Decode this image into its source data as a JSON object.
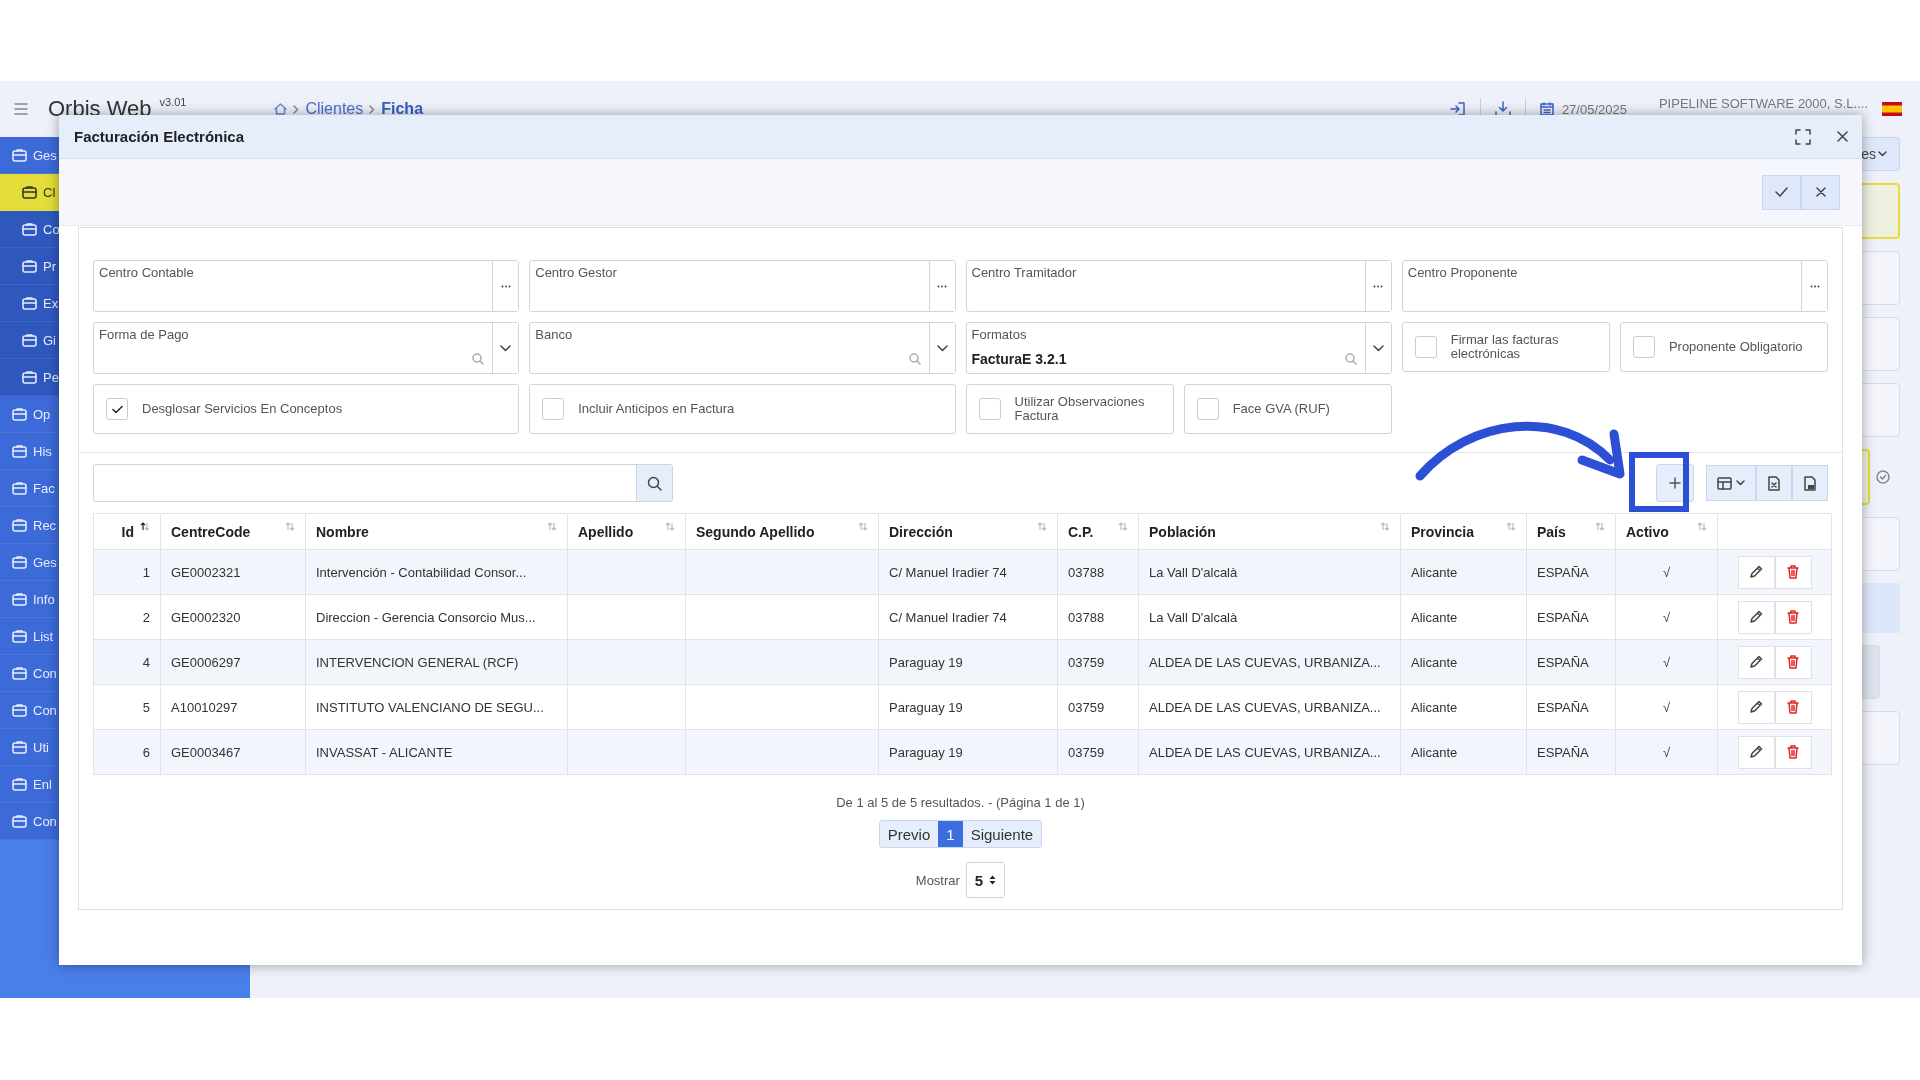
{
  "app": {
    "logo": "Orbis Web",
    "version": "v3.01",
    "breadcrumbs": [
      {
        "label": "Clientes",
        "current": false
      },
      {
        "label": "Ficha",
        "current": true
      }
    ],
    "date": "27/05/2025",
    "company": "PIPELINE SOFTWARE 2000, S.L...."
  },
  "sidebar": {
    "items": [
      {
        "label": "Ges",
        "kind": "group",
        "selected": false
      },
      {
        "label": "Cl",
        "kind": "sub",
        "selected": true
      },
      {
        "label": "Co",
        "kind": "sub",
        "selected": false
      },
      {
        "label": "Pr",
        "kind": "sub",
        "selected": false
      },
      {
        "label": "Ex",
        "kind": "sub",
        "selected": false
      },
      {
        "label": "Gi",
        "kind": "sub",
        "selected": false
      },
      {
        "label": "Pe",
        "kind": "sub",
        "selected": false
      },
      {
        "label": "Op",
        "kind": "group",
        "selected": false
      },
      {
        "label": "His",
        "kind": "group",
        "selected": false
      },
      {
        "label": "Fac",
        "kind": "group",
        "selected": false
      },
      {
        "label": "Rec",
        "kind": "group",
        "selected": false
      },
      {
        "label": "Ges",
        "kind": "group",
        "selected": false
      },
      {
        "label": "Info",
        "kind": "group",
        "selected": false
      },
      {
        "label": "List",
        "kind": "group",
        "selected": false
      },
      {
        "label": "Con",
        "kind": "group",
        "selected": false
      },
      {
        "label": "Con",
        "kind": "group",
        "selected": false
      },
      {
        "label": "Uti",
        "kind": "group",
        "selected": false
      },
      {
        "label": "Enl",
        "kind": "group",
        "selected": false
      },
      {
        "label": "Con",
        "kind": "group",
        "selected": false
      }
    ]
  },
  "background_button": "es",
  "modal": {
    "title": "Facturación Electrónica",
    "fields": [
      {
        "kind": "lookup",
        "label": "Centro Contable"
      },
      {
        "kind": "lookup",
        "label": "Centro Gestor"
      },
      {
        "kind": "lookup",
        "label": "Centro Tramitador"
      },
      {
        "kind": "lookup",
        "label": "Centro Proponente"
      },
      {
        "kind": "select",
        "label": "Forma de Pago"
      },
      {
        "kind": "select",
        "label": "Banco"
      },
      {
        "kind": "select",
        "label": "Formatos",
        "value": "FacturaE 3.2.1"
      },
      {
        "kind": "check",
        "label": "Firmar las facturas electrónicas",
        "checked": false,
        "wide": false
      },
      {
        "kind": "check",
        "label": "Proponente Obligatorio",
        "checked": false,
        "wide": false
      },
      {
        "kind": "check",
        "label": "Desglosar Servicios En Conceptos",
        "checked": true,
        "wide": true
      },
      {
        "kind": "check",
        "label": "Incluir Anticipos en Factura",
        "checked": false,
        "wide": true
      },
      {
        "kind": "check",
        "label": "Utilizar Observaciones Factura",
        "checked": false,
        "wide": false
      },
      {
        "kind": "check",
        "label": "Face GVA (RUF)",
        "checked": false,
        "wide": false
      }
    ],
    "table": {
      "columns": [
        {
          "label": "Id",
          "sorted": true
        },
        {
          "label": "CentreCode",
          "sorted": false
        },
        {
          "label": "Nombre",
          "sorted": false
        },
        {
          "label": "Apellido",
          "sorted": false
        },
        {
          "label": "Segundo Apellido",
          "sorted": false
        },
        {
          "label": "Dirección",
          "sorted": false
        },
        {
          "label": "C.P.",
          "sorted": false
        },
        {
          "label": "Población",
          "sorted": false
        },
        {
          "label": "Provincia",
          "sorted": false
        },
        {
          "label": "País",
          "sorted": false
        },
        {
          "label": "Activo",
          "sorted": false
        }
      ],
      "rows": [
        [
          "1",
          "GE0002321",
          "Intervención - Contabilidad Consor...",
          "",
          "",
          "C/ Manuel Iradier 74",
          "03788",
          "La Vall D'alcalà",
          "Alicante",
          "ESPAÑA",
          "√"
        ],
        [
          "2",
          "GE0002320",
          "Direccion - Gerencia Consorcio Mus...",
          "",
          "",
          "C/ Manuel Iradier 74",
          "03788",
          "La Vall D'alcalà",
          "Alicante",
          "ESPAÑA",
          "√"
        ],
        [
          "4",
          "GE0006297",
          "INTERVENCION GENERAL (RCF)",
          "",
          "",
          "Paraguay 19",
          "03759",
          "ALDEA DE LAS CUEVAS, URBANIZA...",
          "Alicante",
          "ESPAÑA",
          "√"
        ],
        [
          "5",
          "A10010297",
          "INSTITUTO VALENCIANO DE SEGU...",
          "",
          "",
          "Paraguay 19",
          "03759",
          "ALDEA DE LAS CUEVAS, URBANIZA...",
          "Alicante",
          "ESPAÑA",
          "√"
        ],
        [
          "6",
          "GE0003467",
          "INVASSAT - ALICANTE",
          "",
          "",
          "Paraguay 19",
          "03759",
          "ALDEA DE LAS CUEVAS, URBANIZA...",
          "Alicante",
          "ESPAÑA",
          "√"
        ]
      ]
    },
    "pagination": {
      "summary": "De 1 al 5 de 5 resultados. - (Página 1 de 1)",
      "previous": "Previo",
      "pages": [
        {
          "label": "1",
          "selected": true
        }
      ],
      "next": "Siguiente",
      "show_label": "Mostrar",
      "page_size": "5"
    }
  }
}
